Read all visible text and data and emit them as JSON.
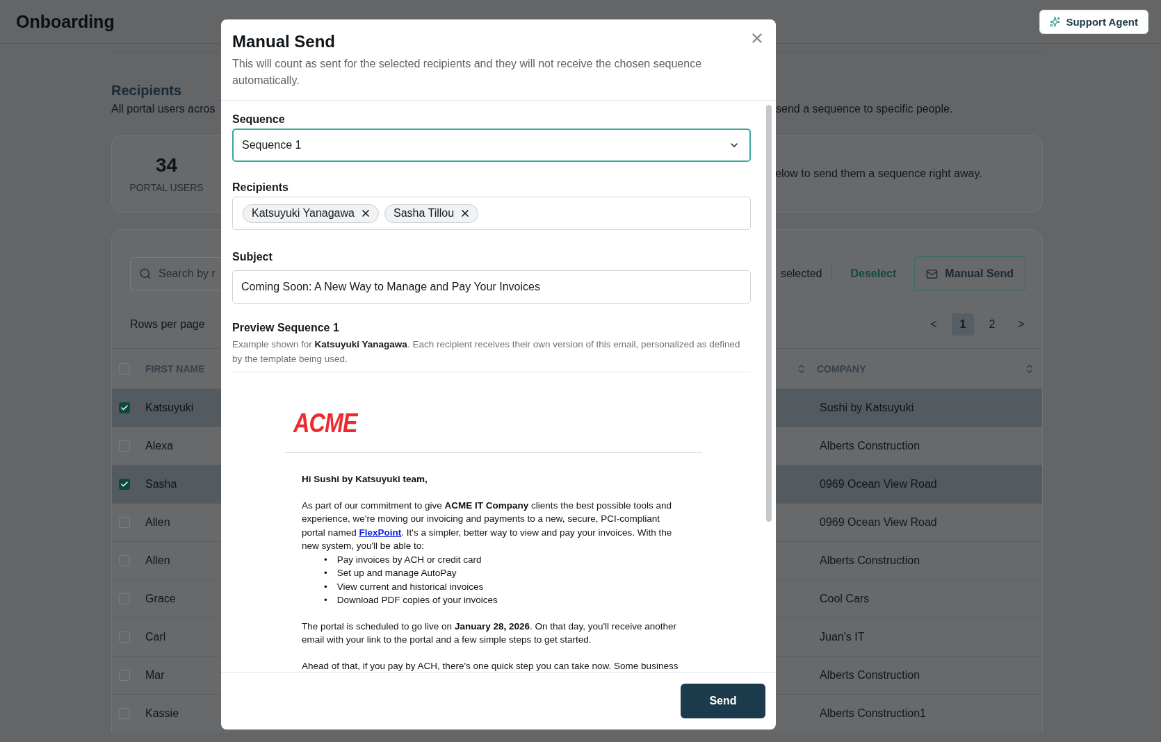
{
  "header": {
    "title": "Onboarding",
    "support_button": "Support Agent"
  },
  "recipients_section": {
    "title": "Recipients",
    "description_left": "All portal users acros",
    "description_right": "send a sequence to specific people."
  },
  "stats": {
    "count": "34",
    "label": "PORTAL USERS",
    "note": "elow to send them a sequence right away."
  },
  "table": {
    "search": {
      "placeholder": "Search by r"
    },
    "selected_text": "selected",
    "deselect": "Deselect",
    "manual_send": "Manual Send",
    "rows_per_page": "Rows per page",
    "pagination": {
      "prev": "<",
      "next": ">",
      "pages": [
        {
          "label": "1",
          "selected": true
        },
        {
          "label": "2",
          "selected": false
        }
      ]
    },
    "header_checked": false,
    "columns": [
      "FIRST NAME",
      "COMPANY"
    ],
    "rows": [
      {
        "first_name": "Katsuyuki",
        "company": "Sushi by Katsuyuki",
        "selected": true
      },
      {
        "first_name": "Alexa",
        "company": "Alberts Construction",
        "selected": false
      },
      {
        "first_name": "Sasha",
        "company": "0969 Ocean View Road",
        "selected": true
      },
      {
        "first_name": "Allen",
        "company": "0969 Ocean View Road",
        "selected": false
      },
      {
        "first_name": "Allen",
        "company": "Alberts Construction",
        "selected": false
      },
      {
        "first_name": "Grace",
        "company": "Cool Cars",
        "selected": false
      },
      {
        "first_name": "Carl",
        "company": "Juan's IT",
        "selected": false
      },
      {
        "first_name": "Mar",
        "company": "Alberts Construction",
        "selected": false
      },
      {
        "first_name": "Kassie",
        "company": "Alberts Construction1",
        "selected": false
      }
    ]
  },
  "modal": {
    "title": "Manual Send",
    "description": "This will count as sent for the selected recipients and they will not receive the chosen sequence automatically.",
    "sequence": {
      "label": "Sequence",
      "value": "Sequence 1"
    },
    "recipients": {
      "label": "Recipients",
      "chips": [
        "Katsuyuki Yanagawa",
        "Sasha Tillou"
      ]
    },
    "subject": {
      "label": "Subject",
      "value": "Coming Soon: A New Way to Manage and Pay Your Invoices"
    },
    "preview": {
      "title": "Preview Sequence 1",
      "description": "Example shown for **Katsuyuki Yanagawa**. Each recipient receives their own version of this email, personalized as defined by the template being used."
    },
    "email": {
      "logo": "ACME",
      "greeting": "Hi Sushi by Katsuyuki team,",
      "paragraph_before_link": "As part of our commitment to give **ACME IT Company** clients the best possible tools and experience, we're moving our invoicing and payments to a new, secure, PCI-compliant portal named ",
      "link": "FlexPoint",
      "paragraph_after_link": ". It's a simpler, better way to view and pay your invoices. With the new system, you'll be able to:",
      "bullet": "•",
      "bullets": [
        "Pay invoices by ACH or credit card",
        "Set up and manage AutoPay",
        "View current and historical invoices",
        "Download PDF copies of your invoices"
      ],
      "paragraph_2": "The portal is scheduled to go live on **January 28, 2026**. On that day, you'll receive another email with your link to the portal and a few simple steps to get started.",
      "paragraph_3": "Ahead of that, if you pay by ACH, there's one quick step you can take now. Some business"
    },
    "send_button": "Send"
  }
}
